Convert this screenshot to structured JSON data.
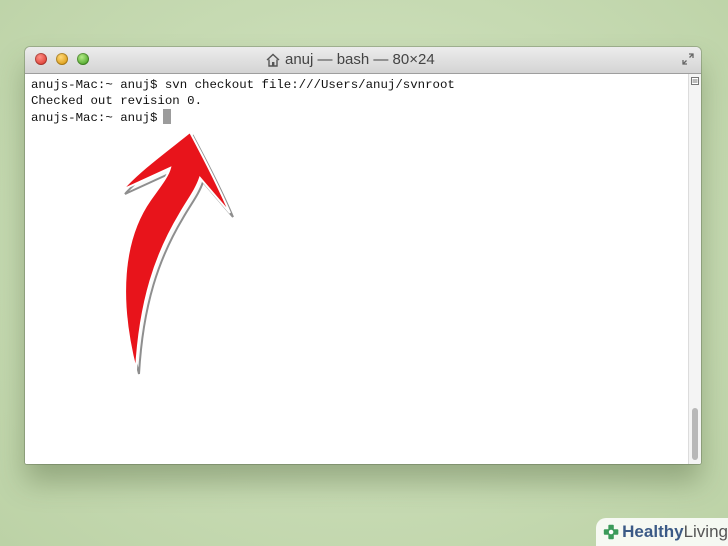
{
  "window": {
    "title": "anuj — bash — 80×24",
    "title_icon": "home-icon"
  },
  "terminal": {
    "lines": [
      "anujs-Mac:~ anuj$ svn checkout file:///Users/anuj/svnroot",
      "Checked out revision 0.",
      "anujs-Mac:~ anuj$"
    ]
  },
  "annotation": {
    "arrow_color": "#e8141b",
    "icon": "red-arrow-icon"
  },
  "watermark": {
    "brand_a": "Healthy",
    "brand_b": "Living",
    "logo": "plus-leaf-icon"
  },
  "colors": {
    "close": "#e0443b",
    "minimize": "#dea01c",
    "maximize": "#53aa2e"
  }
}
